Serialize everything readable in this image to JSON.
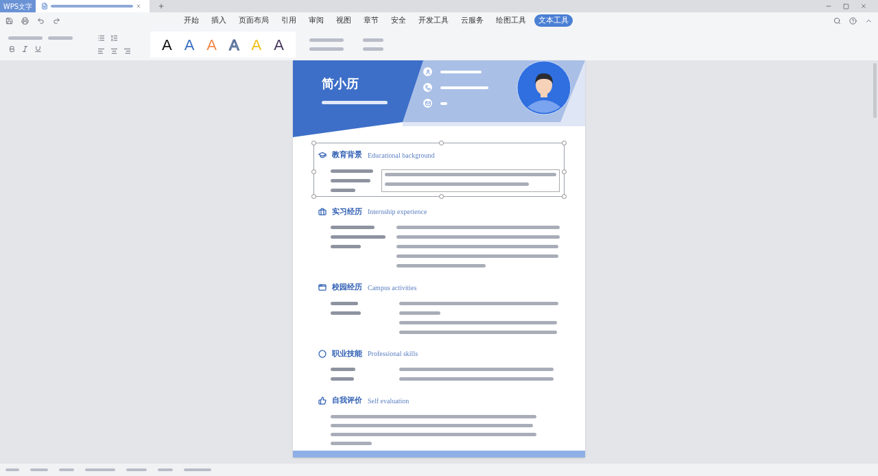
{
  "app_tab": {
    "label": "WPS文字"
  },
  "ribbon_tabs": [
    {
      "label": "开始",
      "selected": false
    },
    {
      "label": "插入",
      "selected": false
    },
    {
      "label": "页面布局",
      "selected": false
    },
    {
      "label": "引用",
      "selected": false
    },
    {
      "label": "审阅",
      "selected": false
    },
    {
      "label": "视图",
      "selected": false
    },
    {
      "label": "章节",
      "selected": false
    },
    {
      "label": "安全",
      "selected": false
    },
    {
      "label": "开发工具",
      "selected": false
    },
    {
      "label": "云服务",
      "selected": false
    },
    {
      "label": "绘图工具",
      "selected": false
    },
    {
      "label": "文本工具",
      "selected": true
    }
  ],
  "text_styles": [
    {
      "label": "A",
      "kind": "solid",
      "color": "#111111"
    },
    {
      "label": "A",
      "kind": "solid",
      "color": "#3a6fc0"
    },
    {
      "label": "A",
      "kind": "solid",
      "color": "#f0884a"
    },
    {
      "label": "A",
      "kind": "outline",
      "color": "#8fa6c8"
    },
    {
      "label": "A",
      "kind": "solid",
      "color": "#f2c01c"
    },
    {
      "label": "A",
      "kind": "solid",
      "color": "#4a3a5e"
    }
  ],
  "resume": {
    "name": "简小历",
    "sections": [
      {
        "kind": "education",
        "title": "教育背景",
        "subtitle": "Educational background",
        "selected": true
      },
      {
        "kind": "internship",
        "title": "实习经历",
        "subtitle": "Internship experience",
        "selected": false
      },
      {
        "kind": "campus",
        "title": "校园经历",
        "subtitle": "Campus activities",
        "selected": false
      },
      {
        "kind": "skills",
        "title": "职业技能",
        "subtitle": "Professional skills",
        "selected": false
      },
      {
        "kind": "self",
        "title": "自我评价",
        "subtitle": "Self evaluation",
        "selected": false
      }
    ]
  }
}
